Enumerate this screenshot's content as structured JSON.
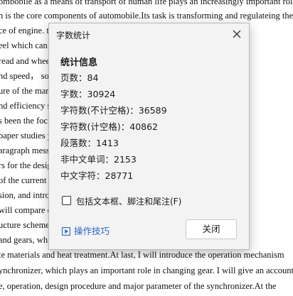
{
  "document": {
    "lines": [
      "ombobile as a means of transport of human life plays an increasingly important role.",
      "n is the core components of automobile.Its task is transforming and regulateing the",
      "ce of engine.                                                                                                                    the power",
      "eel which can                                                                                                                   gine's",
      "read and whee                                                                                                              t vehicle",
      "nd speed， so                                                                                                              mission of",
      "ure of the man                                                                                                              nsmission",
      "nd efficiency                                                                                                                ssion",
      "s been the foc",
      "paper studies                                                                                                                y Rachel",
      "aragraph mess                                                                                                                d engine",
      "rs for the desig                                                                                                             l give a",
      "of the current",
      "sion, and introd                                                                                                         mission.The",
      "will compare                                                                                                                  ose a",
      "ucture scheme.                                                                                                              check of",
      "and gears, wh",
      "te materials and heat treatment.At last, I will introduce the operation mechanism",
      "ynchronizer, which plays an important role in changing gear. I will give an account",
      "e, operation, design procedure and major parameter of the synchronizer.At the"
    ]
  },
  "dialog": {
    "title": "字数统计",
    "section_title": "统计信息",
    "stats": [
      "页数：84",
      "字数：30924",
      "字符数(不计空格)：36589",
      "字符数(计空格)：40862",
      "段落数：1413",
      "非中文单词：2153",
      "中文字符：28771"
    ],
    "checkbox_label": "包括文本框、脚注和尾注(F)",
    "checkbox_checked": false,
    "tips_label": "操作技巧",
    "close_button_label": "关闭",
    "close_icon": "close-icon",
    "tips_icon": "play-icon",
    "link_color": "#2a67c9"
  }
}
